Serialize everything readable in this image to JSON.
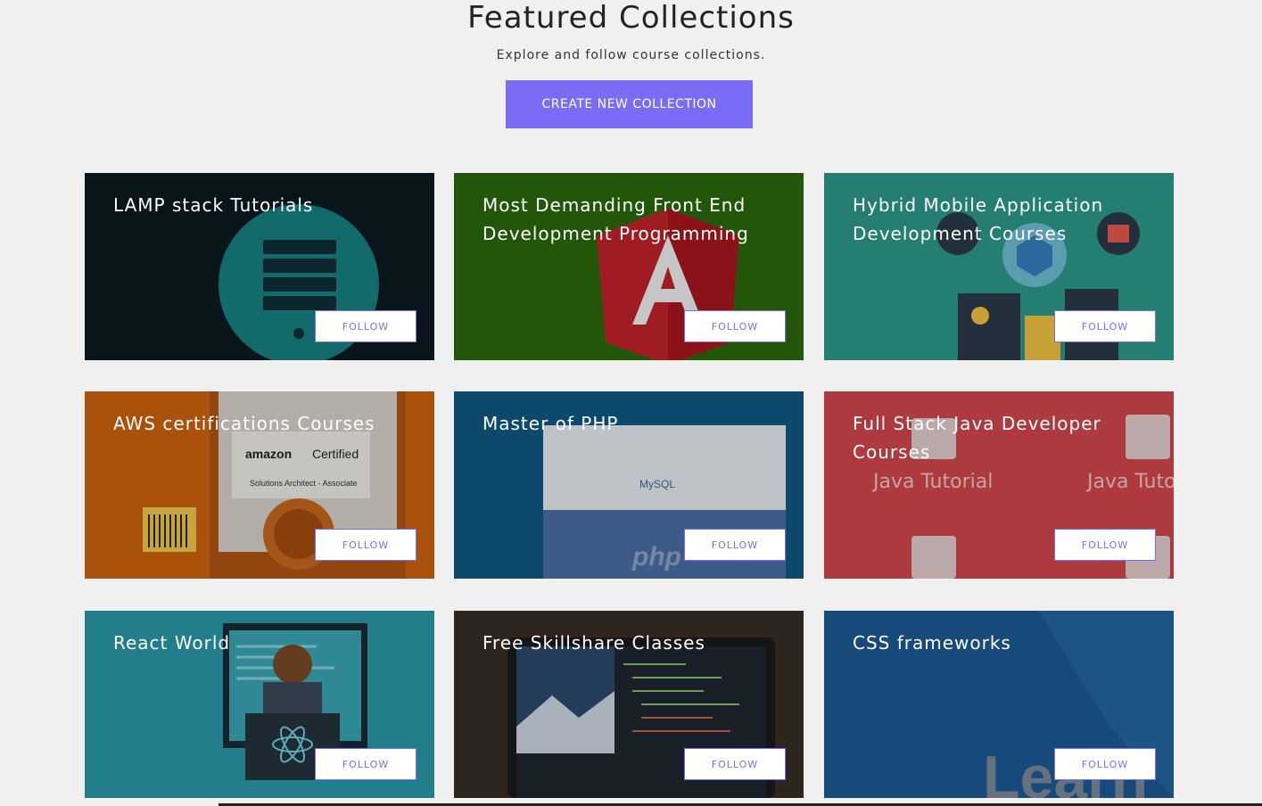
{
  "header": {
    "title": "Featured Collections",
    "subtitle": "Explore and follow course collections.",
    "create_label": "CREATE NEW COLLECTION"
  },
  "colors": {
    "accent": "#7b6cf6",
    "background": "#f0f0f0"
  },
  "collections": [
    {
      "title": "LAMP stack Tutorials",
      "follow_label": "FOLLOW",
      "theme": "dark-teal-server"
    },
    {
      "title": "Most Demanding Front End Development Programming",
      "follow_label": "FOLLOW",
      "theme": "green-angular"
    },
    {
      "title": "Hybrid Mobile Application Development Courses",
      "follow_label": "FOLLOW",
      "theme": "teal-mobile"
    },
    {
      "title": "AWS certifications Courses",
      "follow_label": "FOLLOW",
      "theme": "orange-aws",
      "image_text": "Solutions Architect - Associate",
      "badge_text": "Certified"
    },
    {
      "title": "Master of PHP",
      "follow_label": "FOLLOW",
      "theme": "blue-php",
      "image_text": "MySQL"
    },
    {
      "title": "Full Stack Java Developer Courses",
      "follow_label": "FOLLOW",
      "theme": "red-java",
      "image_text": "Java Tutorial"
    },
    {
      "title": "React World",
      "follow_label": "FOLLOW",
      "theme": "teal-react"
    },
    {
      "title": "Free Skillshare Classes",
      "follow_label": "FOLLOW",
      "theme": "dark-laptop"
    },
    {
      "title": "CSS frameworks",
      "follow_label": "FOLLOW",
      "theme": "blue-css",
      "image_text": "Learn"
    }
  ]
}
